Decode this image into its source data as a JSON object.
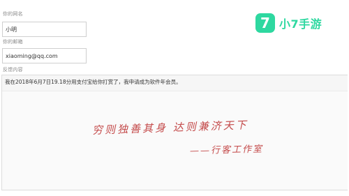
{
  "form": {
    "name_label": "你的网名",
    "name_value": "小明",
    "email_label": "你的邮箱",
    "email_value": "xiaoming@qq.com",
    "feedback_label": "反馈内容",
    "feedback_value": "我在2018年6月7日19.18分用支付宝给你打赏了，我申请成为软件年会员。"
  },
  "signature": {
    "line1": "穷则独善其身 达则兼济天下",
    "line2": "——行客工作室"
  },
  "watermark": {
    "badge": "7",
    "text": "小7手游",
    "color": "#2ed8a0"
  }
}
